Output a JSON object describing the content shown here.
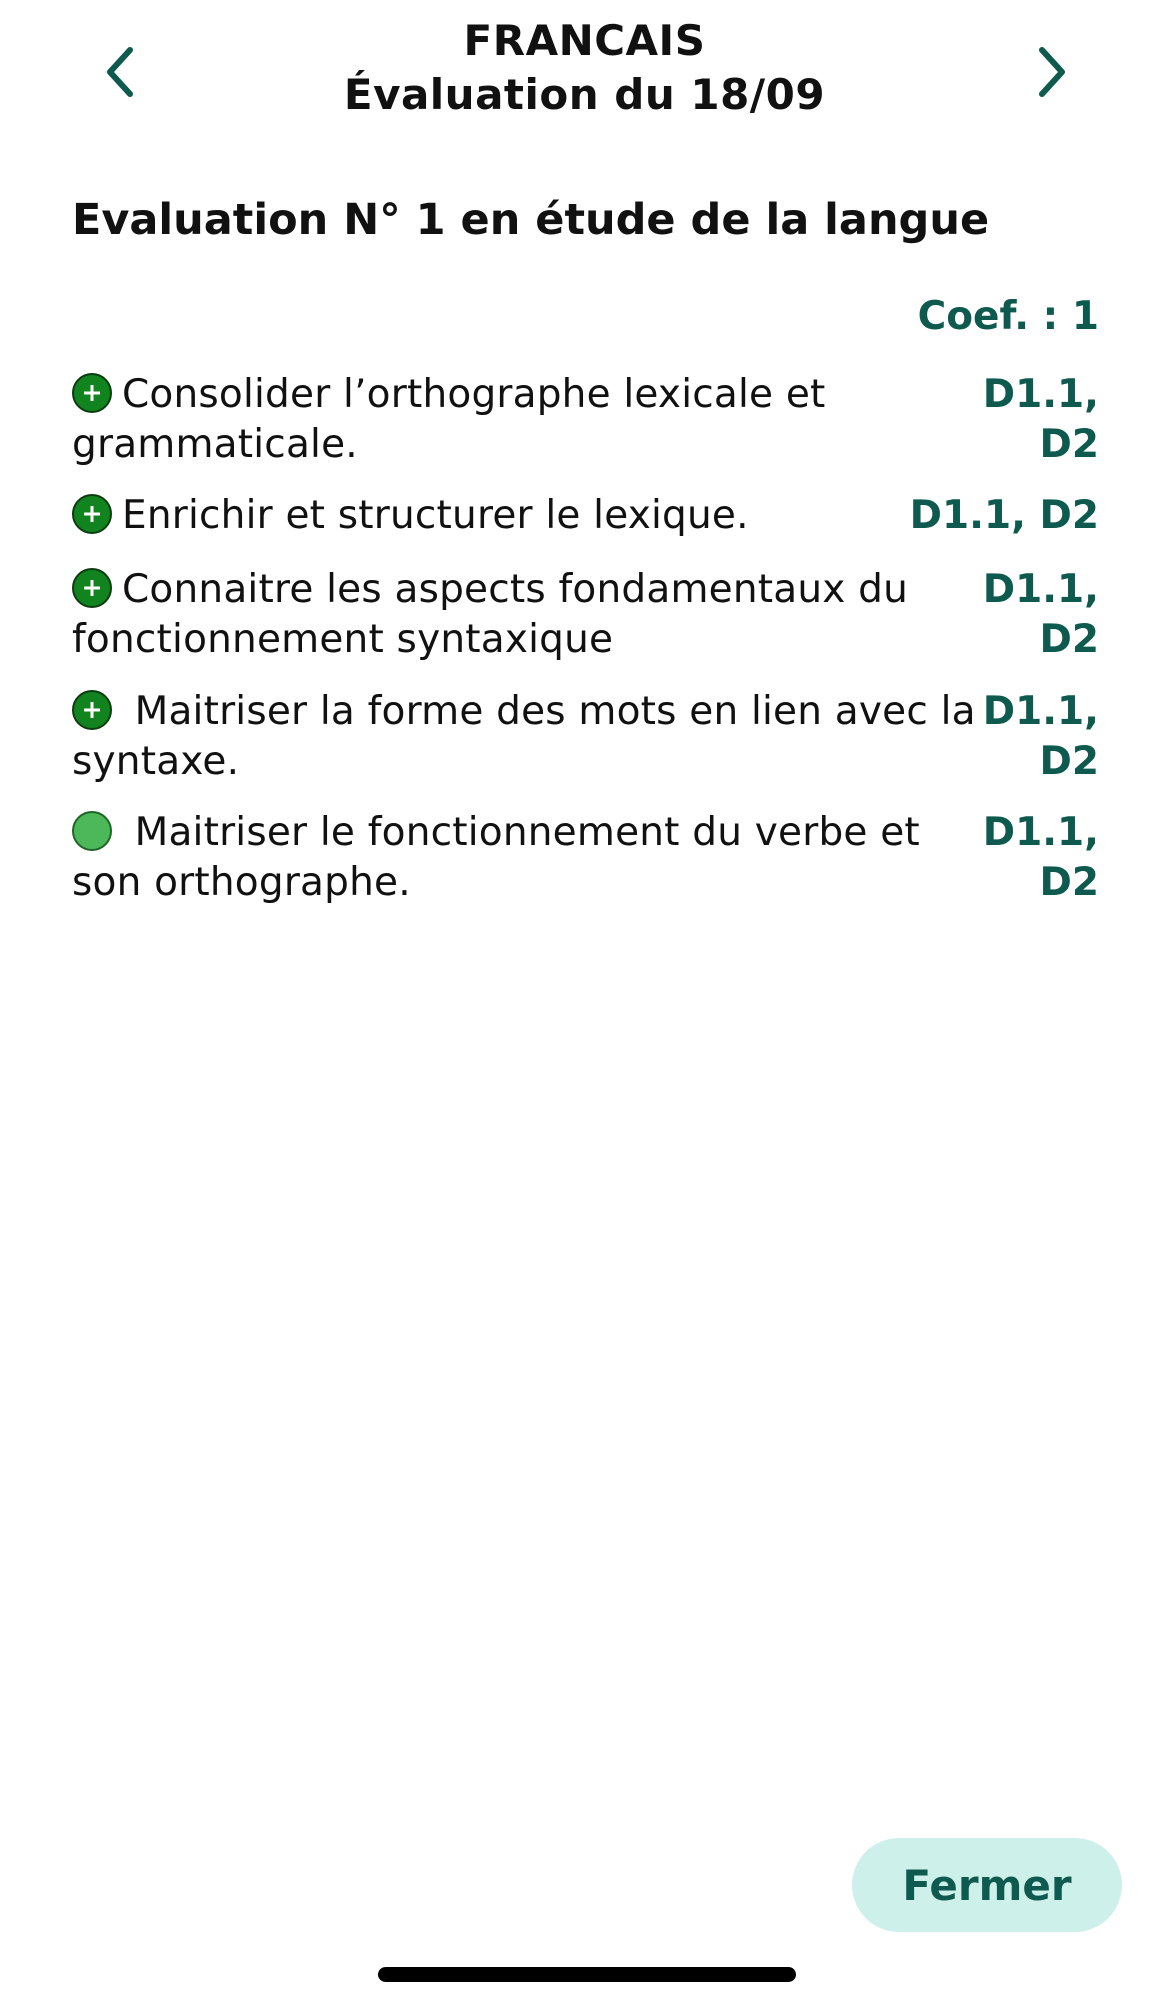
{
  "header": {
    "subject": "FRANCAIS",
    "date_title": "Évaluation du 18/09",
    "prev_icon": "chevron-left-icon",
    "next_icon": "chevron-right-icon",
    "accent_color": "#0e5a4e"
  },
  "evaluation": {
    "title": "Evaluation N° 1 en étude de la langue",
    "coef": "Coef. : 1"
  },
  "items": [
    {
      "text": "Consolider l’orthographe lexicale et grammaticale.",
      "code": "D1.1, D2",
      "icon": "plus-circle-icon",
      "color": "#11831f"
    },
    {
      "text": "Enrichir et structurer le lexique.",
      "code": "D1.1, D2",
      "icon": "plus-circle-icon",
      "color": "#11831f"
    },
    {
      "text": "Connaitre les aspects fondamentaux du fonctionnement syntaxique",
      "code": "D1.1, D2",
      "icon": "plus-circle-icon",
      "color": "#11831f"
    },
    {
      "text": " Maitriser la forme des mots en lien avec la syntaxe.",
      "code": "D1.1, D2",
      "icon": "plus-circle-icon",
      "color": "#11831f"
    },
    {
      "text": " Maitriser le fonctionnement du verbe et son orthographe.",
      "code": "D1.1, D2",
      "icon": "circle-icon",
      "color": "#4cb85a"
    }
  ],
  "footer": {
    "close_label": "Fermer",
    "close_bg": "#cdf0ea"
  }
}
